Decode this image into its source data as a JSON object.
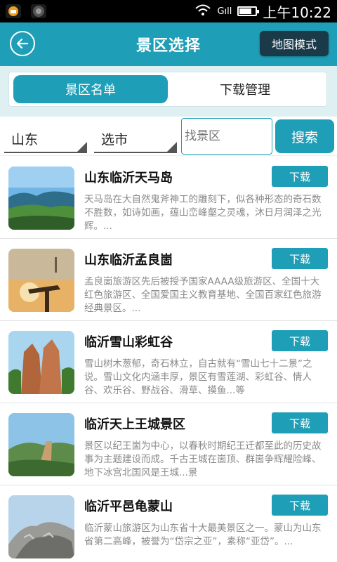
{
  "status_bar": {
    "time": "上午10:22",
    "signal": "Gıll"
  },
  "header": {
    "title": "景区选择",
    "map_mode_label": "地图模式"
  },
  "tabs": [
    {
      "label": "景区名单",
      "active": true
    },
    {
      "label": "下载管理",
      "active": false
    }
  ],
  "filter": {
    "province": "山东",
    "city": "选市",
    "search_placeholder": "找景区",
    "search_label": "搜索"
  },
  "colors": {
    "accent": "#1f9fb7",
    "dark_button": "#1a3a4a"
  },
  "scenic_spots": [
    {
      "name": "山东临沂天马岛",
      "download_label": "下载",
      "description": "天马岛在大自然鬼斧神工的雕刻下，似各种形态的奇石数不胜数，如诗如画，蕴山峦峰壑之灵魂，沐日月润泽之光辉。..."
    },
    {
      "name": "山东临沂孟良崮",
      "download_label": "下载",
      "description": "孟良崮旅游区先后被授予国家AAAA级旅游区、全国十大红色旅游区、全国爱国主义教育基地、全国百家红色旅游经典景区。..."
    },
    {
      "name": "临沂雪山彩虹谷",
      "download_label": "下载",
      "description": "雪山树木葱郁，奇石林立，自古就有“雪山七十二景”之说。雪山文化内涵丰厚，景区有雪莲湖、彩虹谷、情人谷、欢乐谷、野战谷、滑草、摸鱼...等"
    },
    {
      "name": "临沂天上王城景区",
      "download_label": "下载",
      "description": "景区以纪王崮为中心，以春秋时期纪王迁都至此的历史故事为主题建设而成。千古王城在崮顶、群崮争辉耀险峰、地下冰宫北国风是王城...景"
    },
    {
      "name": "临沂平邑龟蒙山",
      "download_label": "下载",
      "description": "临沂蒙山旅游区为山东省十大最美景区之一。蒙山为山东省第二高峰，被誉为“岱宗之亚”，素称“亚岱”。..."
    }
  ]
}
